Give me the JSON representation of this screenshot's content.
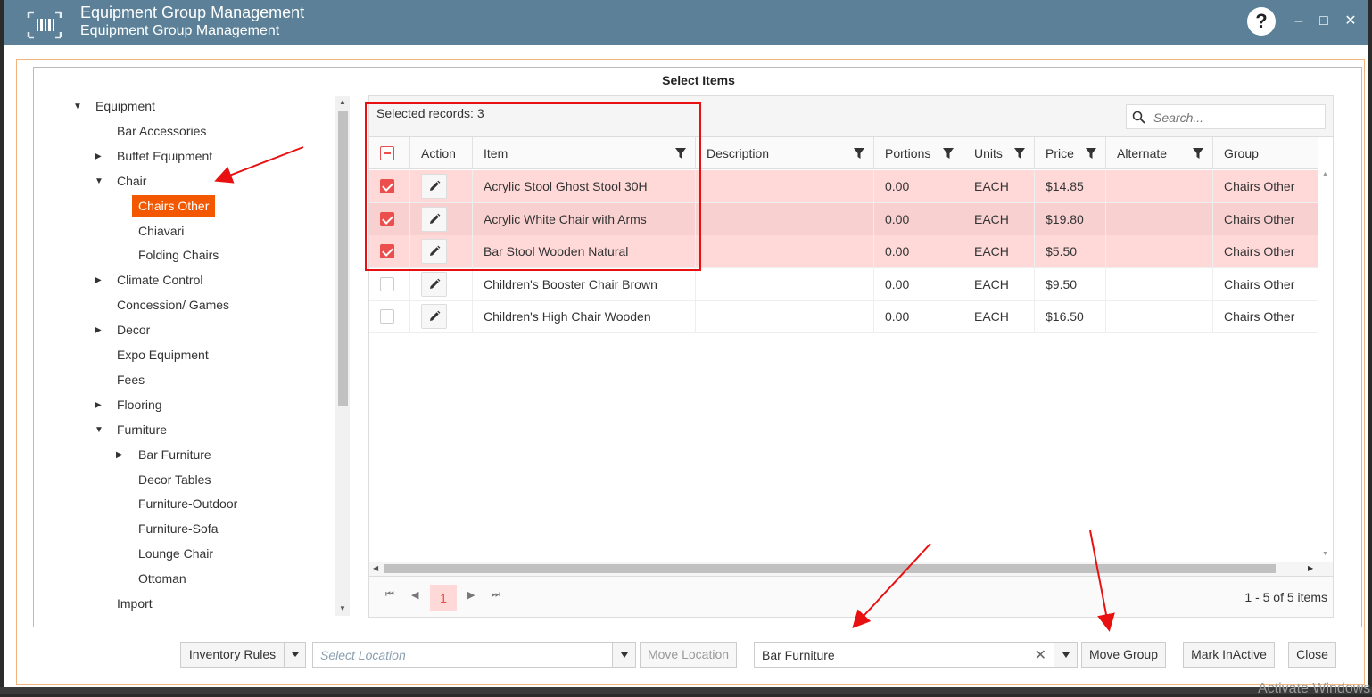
{
  "window": {
    "title": "Equipment Group Management",
    "subtitle": "Equipment Group Management",
    "help_label": "?",
    "minimize": "–",
    "maximize": "□",
    "close": "✕"
  },
  "panel": {
    "title": "Select Items"
  },
  "tree": {
    "nodes": [
      {
        "label": "Equipment",
        "level": 0,
        "toggle": "expanded"
      },
      {
        "label": "Bar Accessories",
        "level": 1,
        "toggle": "none"
      },
      {
        "label": "Buffet Equipment",
        "level": 1,
        "toggle": "collapsed"
      },
      {
        "label": "Chair",
        "level": 1,
        "toggle": "expanded"
      },
      {
        "label": "Chairs Other",
        "level": 2,
        "toggle": "none",
        "selected": true
      },
      {
        "label": "Chiavari",
        "level": 2,
        "toggle": "none"
      },
      {
        "label": "Folding Chairs",
        "level": 2,
        "toggle": "none"
      },
      {
        "label": "Climate Control",
        "level": 1,
        "toggle": "collapsed"
      },
      {
        "label": "Concession/ Games",
        "level": 1,
        "toggle": "none"
      },
      {
        "label": "Decor",
        "level": 1,
        "toggle": "collapsed"
      },
      {
        "label": "Expo Equipment",
        "level": 1,
        "toggle": "none"
      },
      {
        "label": "Fees",
        "level": 1,
        "toggle": "none"
      },
      {
        "label": "Flooring",
        "level": 1,
        "toggle": "collapsed"
      },
      {
        "label": "Furniture",
        "level": 1,
        "toggle": "expanded"
      },
      {
        "label": "Bar Furniture",
        "level": 2,
        "toggle": "collapsed"
      },
      {
        "label": "Decor Tables",
        "level": 2,
        "toggle": "none"
      },
      {
        "label": "Furniture-Outdoor",
        "level": 2,
        "toggle": "none"
      },
      {
        "label": "Furniture-Sofa",
        "level": 2,
        "toggle": "none"
      },
      {
        "label": "Lounge Chair",
        "level": 2,
        "toggle": "none"
      },
      {
        "label": "Ottoman",
        "level": 2,
        "toggle": "none"
      },
      {
        "label": "Import",
        "level": 1,
        "toggle": "none"
      }
    ]
  },
  "grid": {
    "selected_records": "Selected records: 3",
    "search_placeholder": "Search...",
    "columns": [
      "",
      "Action",
      "Item",
      "Description",
      "Portions",
      "Units",
      "Price",
      "Alternate",
      "Group"
    ],
    "rows": [
      {
        "checked": true,
        "item": "Acrylic Stool Ghost Stool 30H",
        "description": "",
        "portions": "0.00",
        "units": "EACH",
        "price": "$14.85",
        "alternate": "",
        "group": "Chairs Other"
      },
      {
        "checked": true,
        "item": "Acrylic White Chair with Arms",
        "description": "",
        "portions": "0.00",
        "units": "EACH",
        "price": "$19.80",
        "alternate": "",
        "group": "Chairs Other"
      },
      {
        "checked": true,
        "item": "Bar Stool Wooden Natural",
        "description": "",
        "portions": "0.00",
        "units": "EACH",
        "price": "$5.50",
        "alternate": "",
        "group": "Chairs Other"
      },
      {
        "checked": false,
        "item": "Children's Booster Chair Brown",
        "description": "",
        "portions": "0.00",
        "units": "EACH",
        "price": "$9.50",
        "alternate": "",
        "group": "Chairs Other"
      },
      {
        "checked": false,
        "item": "Children's High Chair Wooden",
        "description": "",
        "portions": "0.00",
        "units": "EACH",
        "price": "$16.50",
        "alternate": "",
        "group": "Chairs Other"
      }
    ],
    "pager": {
      "current_page": "1",
      "info": "1 - 5 of 5 items"
    }
  },
  "bottom_bar": {
    "inventory_rules": "Inventory Rules",
    "location_placeholder": "Select Location",
    "move_location": "Move Location",
    "group_value": "Bar Furniture",
    "move_group": "Move Group",
    "mark_inactive": "Mark InActive",
    "close": "Close"
  },
  "watermark": "Activate Windows",
  "colors": {
    "titlebar": "#5b8097",
    "tree_selected": "#f35800",
    "row_selected": "#ffd8d8",
    "checkbox": "#ec4d4d",
    "annotation_red": "#e81010"
  }
}
